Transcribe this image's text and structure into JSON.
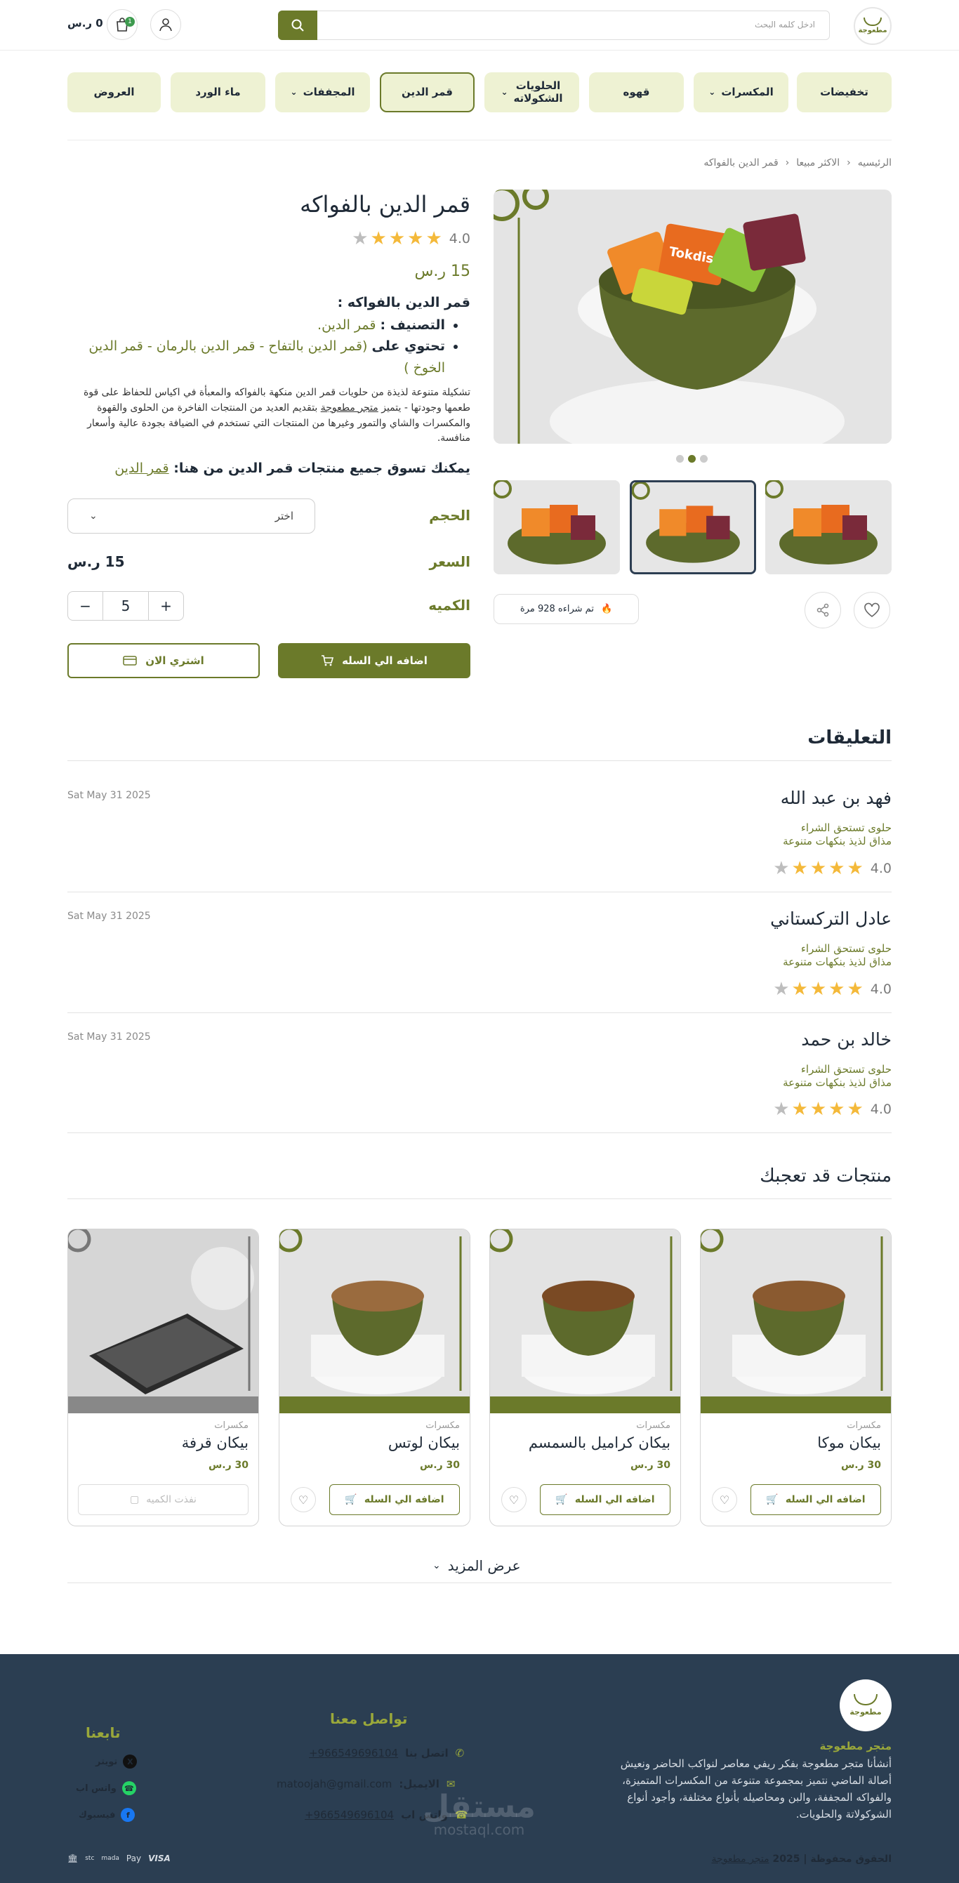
{
  "header": {
    "logo_text": "مطعوجة",
    "search_placeholder": "ادخل كلمه البحث",
    "cart_count": "1",
    "cart_total": "0 ر.س"
  },
  "nav": [
    {
      "label": "تخفيضات",
      "dropdown": false
    },
    {
      "label": "المكسرات",
      "dropdown": true
    },
    {
      "label": "قهوه",
      "dropdown": false
    },
    {
      "label": "الحلويات الشكولاته",
      "dropdown": true
    },
    {
      "label": "قمر الدين",
      "dropdown": false,
      "active": true
    },
    {
      "label": "المجففات",
      "dropdown": true
    },
    {
      "label": "ماء الورد",
      "dropdown": false
    },
    {
      "label": "العروض",
      "dropdown": false
    }
  ],
  "breadcrumb": [
    "الرئيسيه",
    "الاكثر مبيعا",
    "قمر الدين بالفواكه"
  ],
  "product": {
    "title": "قمر الدين بالفواكه",
    "rating": "4.0",
    "rating_value": 4,
    "price": "15 ر.س",
    "desc_heading": "قمر الدين بالفواكه :",
    "category_label": "التصنيف :",
    "category_value": "قمر الدين.",
    "contains_label": "تحتوي على",
    "contains_value": "(قمر الدين بالتفاح - قمر الدين بالرمان - قمر الدين الخوخ )",
    "paragraph_1": "تشكيلة متنوعة لذيذة من حلويات قمر الدين منكهة بالفواكه والمعبأة في اكياس للحفاظ على قوة طعمها وجودتها - يتميز ",
    "paragraph_link": "متجر مطعوجة",
    "paragraph_2": " بتقديم العديد من المنتجات الفاخرة من الحلوى والقهوة والمكسرات والشاي والتمور وغيرها من المنتجات التي تستخدم في الضيافة بجودة عالية وأسعار منافسة.",
    "shop_all_text": "يمكنك تسوق جميع منتجات قمر الدين من هنا:",
    "shop_all_link": "قمر الدين",
    "size_label": "الحجم",
    "size_placeholder": "اختر",
    "price_label": "السعر",
    "price_value": "15 ر.س",
    "qty_label": "الكميه",
    "qty_value": "5",
    "add_to_cart": "اضافه الي السله",
    "buy_now": "اشتري الان",
    "sold_text": "تم شراءه 928 مرة",
    "image_brand": "Tokdis"
  },
  "reviews": {
    "title": "التعليقات",
    "items": [
      {
        "name": "فهد بن عبد الله",
        "line1": "حلوى تستحق الشراء",
        "line2": "مذاق لذيذ بنكهات متنوعة",
        "rating": "4.0",
        "date": "Sat May 31 2025"
      },
      {
        "name": "عادل التركستاني",
        "line1": "حلوى تستحق الشراء",
        "line2": "مذاق لذيذ بنكهات متنوعة",
        "rating": "4.0",
        "date": "Sat May 31 2025"
      },
      {
        "name": "خالد بن حمد",
        "line1": "حلوى تستحق الشراء",
        "line2": "مذاق لذيذ بنكهات متنوعة",
        "rating": "4.0",
        "date": "Sat May 31 2025"
      }
    ]
  },
  "related": {
    "title": "منتجات قد تعجبك",
    "items": [
      {
        "category": "مكسرات",
        "name": "بيكان موكا",
        "price": "30 ر.س",
        "button": "اضافه الي السله"
      },
      {
        "category": "مكسرات",
        "name": "بيكان كراميل بالسمسم",
        "price": "30 ر.س",
        "button": "اضافه الي السله"
      },
      {
        "category": "مكسرات",
        "name": "بيكان لوتس",
        "price": "30 ر.س",
        "button": "اضافه الي السله"
      },
      {
        "category": "مكسرات",
        "name": "بيكان قرفة",
        "price": "30 ر.س",
        "button": "نفذت الكميه"
      }
    ],
    "more": "عرض المزيد"
  },
  "footer": {
    "store_name": "متجر مطعوجة",
    "description": "أنشأنا متجر مطعوجة بفكر ريفي معاصر لنواكب الحاضر ونعيش أصالة الماضي نتميز بمجموعة متنوعة من المكسرات المتميزة، والفواكه المجففة، والبن ومحاصيله بأنواع مختلفة، وأجود أنواع الشوكولاتة والحلويات.",
    "contact_title": "تواصل معنا",
    "call_label": "اتصل بنا",
    "call_value": "+966549696104",
    "email_label": "الايميل:",
    "email_value": "matoojah@gmail.com",
    "whatsapp_label": "واتس اب",
    "whatsapp_value": "+966549696104",
    "follow_title": "تابعنا",
    "social": [
      "تويتر",
      "واتس اب",
      "فيسبوك"
    ],
    "copyright_prefix": "الحقوق محفوظة | 2025 ",
    "copyright_link": "متجر مطعوجة",
    "payments": [
      "VISA",
      "Pay",
      "mada",
      "stc"
    ],
    "watermark": "مستقل",
    "watermark_url": "mostaql.com"
  },
  "colors": {
    "brand": "#6b7a2a",
    "nav_bg": "#eef2d3",
    "footer_bg": "#2b3e52",
    "star": "#f4b93a"
  }
}
